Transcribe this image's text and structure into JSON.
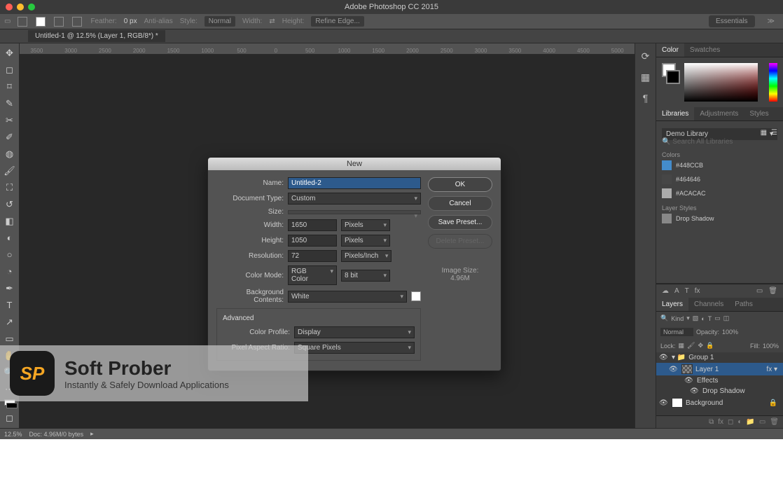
{
  "app": {
    "title": "Adobe Photoshop CC 2015",
    "workspace": "Essentials"
  },
  "options_bar": {
    "feather_label": "Feather:",
    "feather_value": "0 px",
    "antialias": "Anti-alias",
    "style_label": "Style:",
    "style_value": "Normal",
    "width_label": "Width:",
    "height_label": "Height:",
    "refine_edge": "Refine Edge..."
  },
  "document_tab": "Untitled-1 @ 12.5% (Layer 1, RGB/8*) *",
  "ruler_marks": [
    "3500",
    "3000",
    "2500",
    "2000",
    "1500",
    "1000",
    "500",
    "0",
    "500",
    "1000",
    "1500",
    "2000",
    "2500",
    "3000",
    "3500",
    "4000",
    "4500",
    "5000"
  ],
  "panels": {
    "tabs": [
      "Color",
      "Swatches"
    ],
    "libraries_tabs": [
      "Libraries",
      "Adjustments",
      "Styles"
    ],
    "library_select": "Demo Library",
    "search_placeholder": "Search All Libraries",
    "colors_header": "Colors",
    "colors": [
      {
        "hex": "#448CCB"
      },
      {
        "hex": "#464646"
      },
      {
        "hex": "#ACACAC"
      }
    ],
    "layer_styles_header": "Layer Styles",
    "layer_style_item": "Drop Shadow",
    "layers_tabs": [
      "Layers",
      "Channels",
      "Paths"
    ],
    "filter_kind": "Kind",
    "blend_mode": "Normal",
    "opacity_label": "Opacity:",
    "opacity_value": "100%",
    "lock_label": "Lock:",
    "fill_label": "Fill:",
    "fill_value": "100%",
    "layer_tree": {
      "group": "Group 1",
      "layer1": "Layer 1",
      "effects": "Effects",
      "drop_shadow": "Drop Shadow",
      "background": "Background"
    }
  },
  "dialog": {
    "title": "New",
    "name_label": "Name:",
    "name_value": "Untitled-2",
    "doc_type_label": "Document Type:",
    "doc_type_value": "Custom",
    "size_label": "Size:",
    "width_label": "Width:",
    "width_value": "1650",
    "width_unit": "Pixels",
    "height_label": "Height:",
    "height_value": "1050",
    "height_unit": "Pixels",
    "resolution_label": "Resolution:",
    "resolution_value": "72",
    "resolution_unit": "Pixels/Inch",
    "color_mode_label": "Color Mode:",
    "color_mode_value": "RGB Color",
    "color_depth": "8 bit",
    "bg_label": "Background Contents:",
    "bg_value": "White",
    "advanced": "Advanced",
    "color_profile_label": "Color Profile:",
    "color_profile_value": "Display",
    "pixel_aspect_label": "Pixel Aspect Ratio:",
    "pixel_aspect_value": "Square Pixels",
    "ok": "OK",
    "cancel": "Cancel",
    "save_preset": "Save Preset...",
    "delete_preset": "Delete Preset...",
    "image_size_label": "Image Size:",
    "image_size_value": "4.96M"
  },
  "statusbar": {
    "zoom": "12.5%",
    "doc_info": "Doc: 4.96M/0 bytes"
  },
  "watermark": {
    "logo_text": "SP",
    "brand": "Soft Prober",
    "tagline": "Instantly & Safely Download Applications"
  }
}
